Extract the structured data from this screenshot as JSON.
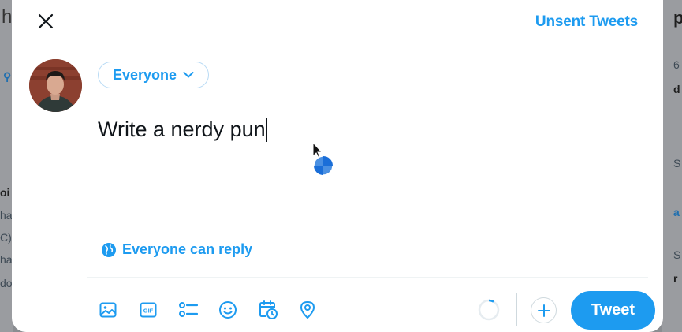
{
  "dialog": {
    "unsent_label": "Unsent Tweets",
    "audience_label": "Everyone",
    "composer_text": "Write a nerdy pun",
    "reply_setting_label": "Everyone can reply",
    "tweet_button_label": "Tweet"
  },
  "toolbar": {
    "icons": [
      "media-icon",
      "gif-icon",
      "poll-icon",
      "emoji-icon",
      "schedule-icon",
      "location-icon"
    ]
  },
  "background": {
    "left_fragments": [
      "h",
      "oi",
      "ha",
      "C)",
      "ha",
      "do"
    ],
    "right_fragments": [
      "p",
      "6",
      "d",
      "S",
      "a",
      "S",
      "r"
    ]
  },
  "colors": {
    "accent": "#1d9bf0",
    "text": "#0f1419",
    "border": "#cfd9de"
  }
}
